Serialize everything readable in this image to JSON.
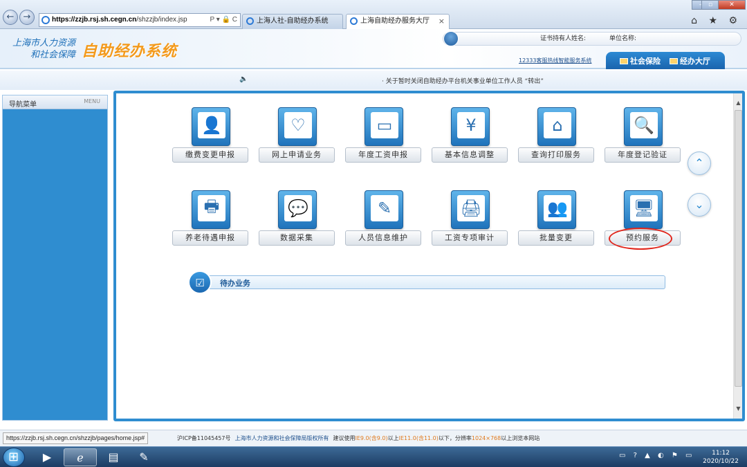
{
  "browser": {
    "address_domain": "https://zzjb.rsj.sh.cegn.cn",
    "address_path": "/shzzjb/index.jsp",
    "address_tools": "P ▾ 🔒 C",
    "tabs": [
      {
        "label": "上海人社-自助经办系统"
      },
      {
        "label": "上海自助经办服务大厅"
      }
    ],
    "right_icons": "⌂ ★ ⚙"
  },
  "header": {
    "logo_line1": "上海市人力资源",
    "logo_line2": "和社会保障",
    "logo_big": "自助经办系统",
    "cert_holder_label": "证书持有人姓名:",
    "unit_label": "单位名称:",
    "hotline_link": "12333客服热线智能服务系统",
    "nav_tabs": [
      {
        "label": "社会保险"
      },
      {
        "label": "经办大厅"
      }
    ]
  },
  "notice": {
    "text": "· 关于暂时关闭自助经办平台机关事业单位工作人员 “转出”"
  },
  "sidebar": {
    "title": "导航菜单",
    "menu_label": "MENU"
  },
  "services": {
    "row1": [
      {
        "label": "缴费变更申报",
        "icon": "👤"
      },
      {
        "label": "网上申请业务",
        "icon": "♡"
      },
      {
        "label": "年度工资申报",
        "icon": "▭"
      },
      {
        "label": "基本信息调整",
        "icon": "¥"
      },
      {
        "label": "查询打印服务",
        "icon": "⌂"
      },
      {
        "label": "年度登记验证",
        "icon": "🔍"
      }
    ],
    "row2": [
      {
        "label": "养老待遇申报",
        "icon": "🖶"
      },
      {
        "label": "数据采集",
        "icon": "💬"
      },
      {
        "label": "人员信息维护",
        "icon": "✎"
      },
      {
        "label": "工资专项审计",
        "icon": "🖨"
      },
      {
        "label": "批量变更",
        "icon": "👥"
      },
      {
        "label": "预约服务",
        "icon": "🖥"
      }
    ]
  },
  "pending": {
    "label": "待办业务"
  },
  "status": {
    "url": "https://zzjb.rsj.sh.cegn.cn/shzzjb/pages/home.jsp#",
    "icp": "沪ICP备11045457号",
    "copyright": "上海市人力资源和社会保障局版权所有",
    "rec_prefix": "建议使用",
    "rec_ie9": "IE9.0(含9.0)",
    "rec_mid1": "以上",
    "rec_ie11": "IE11.0(含11.0)",
    "rec_mid2": "以下，分辨率",
    "rec_res": "1024×768",
    "rec_suffix": "以上浏览本网站"
  },
  "taskbar": {
    "tray": "▭ ? ▲ ◐ ⚑ ▭",
    "time": "11:12",
    "date": "2020/10/22"
  }
}
